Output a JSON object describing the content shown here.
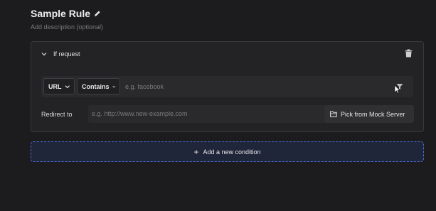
{
  "rule": {
    "title": "Sample Rule",
    "description_placeholder": "Add description (optional)"
  },
  "condition": {
    "header_label": "If request",
    "source_key": "URL",
    "operator": "Contains",
    "match_placeholder": "e.g. facebook"
  },
  "redirect": {
    "label": "Redirect to",
    "placeholder": "e.g. http://www.new-example.com",
    "mock_button_label": "Pick from Mock Server"
  },
  "actions": {
    "add_condition_label": "Add a new condition"
  },
  "colors": {
    "background": "#1c1c1e",
    "card": "#232325",
    "accent_border": "#4a6bd6",
    "add_condition_bg": "#20263a"
  },
  "icons": [
    "pencil-icon",
    "chevron-down-icon",
    "trash-icon",
    "filter-icon",
    "mouse-cursor-icon",
    "folder-open-icon",
    "plus-icon"
  ]
}
